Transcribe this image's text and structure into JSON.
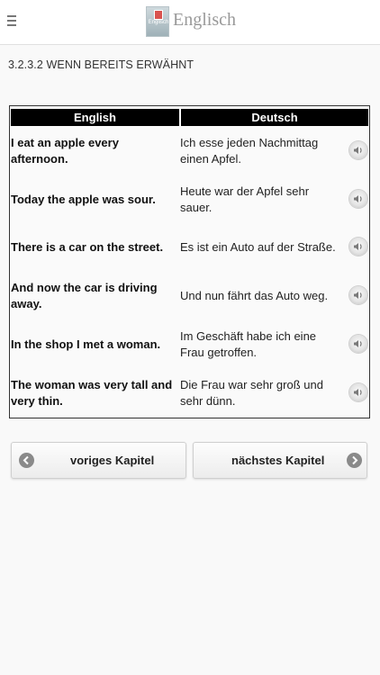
{
  "header": {
    "menu_icon": "hamburger-menu-icon",
    "logo_text": "Englisch",
    "title": "Englisch"
  },
  "section": {
    "heading": "3.2.3.2 WENN BEREITS ERWÄHNT"
  },
  "table": {
    "columns": [
      "English",
      "Deutsch"
    ],
    "rows": [
      {
        "en": "I eat an apple every afternoon.",
        "de": "Ich esse jeden Nachmittag einen Apfel."
      },
      {
        "en": "Today the apple was sour.",
        "de": "Heute war der Apfel sehr sauer."
      },
      {
        "en": "There is a car on the street.",
        "de": "Es ist ein Auto auf der Straße."
      },
      {
        "en": "And now the car is driving away.",
        "de": "Und nun fährt das Auto weg."
      },
      {
        "en": "In the shop I met a woman.",
        "de": "Im Geschäft habe ich eine Frau getroffen."
      },
      {
        "en": "The woman was very tall and very thin.",
        "de": "Die Frau war sehr groß und sehr dünn."
      }
    ],
    "row_icon": "speaker-icon"
  },
  "nav": {
    "prev_label": "voriges Kapitel",
    "next_label": "nächstes Kapitel",
    "prev_icon": "arrow-left-icon",
    "next_icon": "arrow-right-icon"
  },
  "colors": {
    "header_bg": "#ffffff",
    "table_header_bg": "#000000",
    "page_bg": "#f9f9f9"
  }
}
